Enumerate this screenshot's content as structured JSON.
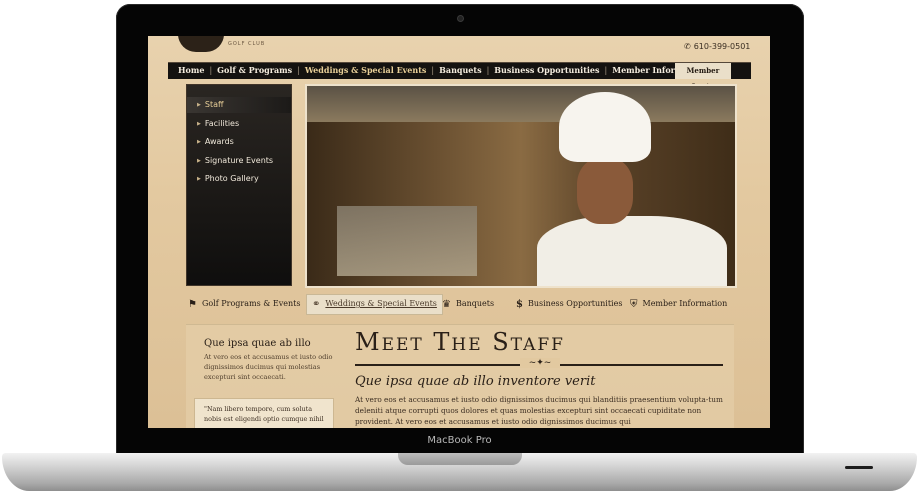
{
  "device": {
    "brand_label": "MacBook Pro"
  },
  "site": {
    "logo_sub": "GOLF CLUB",
    "phone": "610-399-0501",
    "nav": [
      "Home",
      "Golf & Programs",
      "Weddings & Special Events",
      "Banquets",
      "Business Opportunities",
      "Member Information"
    ],
    "nav_active_index": 2,
    "login_label": "Member Login",
    "sidebar": [
      "Staff",
      "Facilities",
      "Awards",
      "Signature Events",
      "Photo Gallery"
    ],
    "categories": [
      {
        "label": "Golf Programs & Events",
        "icon": "golf-flag-icon"
      },
      {
        "label": "Weddings & Special Events",
        "icon": "rings-icon"
      },
      {
        "label": "Banquets",
        "icon": "banquet-icon"
      },
      {
        "label": "Business Opportunities",
        "icon": "dollar-icon"
      },
      {
        "label": "Member Information",
        "icon": "shield-icon"
      }
    ],
    "left_heading": "Que ipsa quae ab illo",
    "left_text": "At vero eos et accusamus et iusto odio dignissimos ducimus qui molestias excepturi sint occaecati.",
    "quote_text": "\"Nam libero tempore, cum soluta nobis est eligendi optio cumque nihil",
    "page_title": "Meet The Staff",
    "subheading": "Que ipsa quae ab illo inventore verit",
    "body_text": "At vero eos et accusamus et iusto odio dignissimos ducimus qui blanditiis praesentium volupta-tum deleniti atque corrupti quos dolores et quas molestias excepturi sint occaecati cupiditate non provident. At vero eos et accusamus et iusto odio dignissimos ducimus qui"
  },
  "colors": {
    "nav_bg": "#141210",
    "page_bg": "#e3c9a0",
    "accent": "#e8cf98"
  }
}
